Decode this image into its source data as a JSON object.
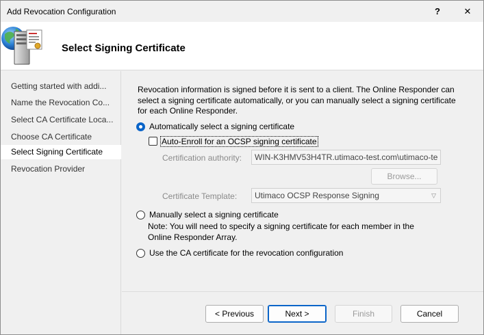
{
  "window": {
    "title": "Add Revocation Configuration"
  },
  "titlebar": {
    "help_label": "?",
    "close_label": "✕"
  },
  "header": {
    "title": "Select Signing Certificate",
    "icon": "server-certificate-icon"
  },
  "nav": {
    "items": [
      {
        "label": "Getting started with addi...",
        "active": false
      },
      {
        "label": "Name the Revocation Co...",
        "active": false
      },
      {
        "label": "Select CA Certificate Loca...",
        "active": false
      },
      {
        "label": "Choose CA Certificate",
        "active": false
      },
      {
        "label": "Select Signing Certificate",
        "active": true
      },
      {
        "label": "Revocation Provider",
        "active": false
      }
    ]
  },
  "content": {
    "description": "Revocation information is signed before it is sent to a client. The Online Responder can select a signing certificate automatically, or you can manually select a signing certificate for each Online Responder.",
    "auto_option": {
      "label": "Automatically select a signing certificate",
      "checked": true
    },
    "auto_enroll": {
      "label": "Auto-Enroll for an OCSP signing certificate",
      "checked": false
    },
    "cert_authority": {
      "label": "Certification authority:",
      "value": "WIN-K3HMV53H4TR.utimaco-test.com\\utimaco-te"
    },
    "browse_label": "Browse...",
    "cert_template": {
      "label": "Certificate Template:",
      "value": "Utimaco OCSP Response Signing"
    },
    "manual_option": {
      "label": "Manually select a signing certificate",
      "checked": false
    },
    "manual_note_1": "Note: You will need to specify a signing certificate for each member in the",
    "manual_note_2": "Online Responder Array.",
    "ca_option": {
      "label": "Use the CA certificate for the revocation configuration",
      "checked": false
    }
  },
  "footer": {
    "previous_label": "< Previous",
    "next_label": "Next >",
    "finish_label": "Finish",
    "cancel_label": "Cancel"
  },
  "colors": {
    "accent": "#0a64c8",
    "background": "#f0f0f0",
    "header_bg": "#ffffff"
  }
}
